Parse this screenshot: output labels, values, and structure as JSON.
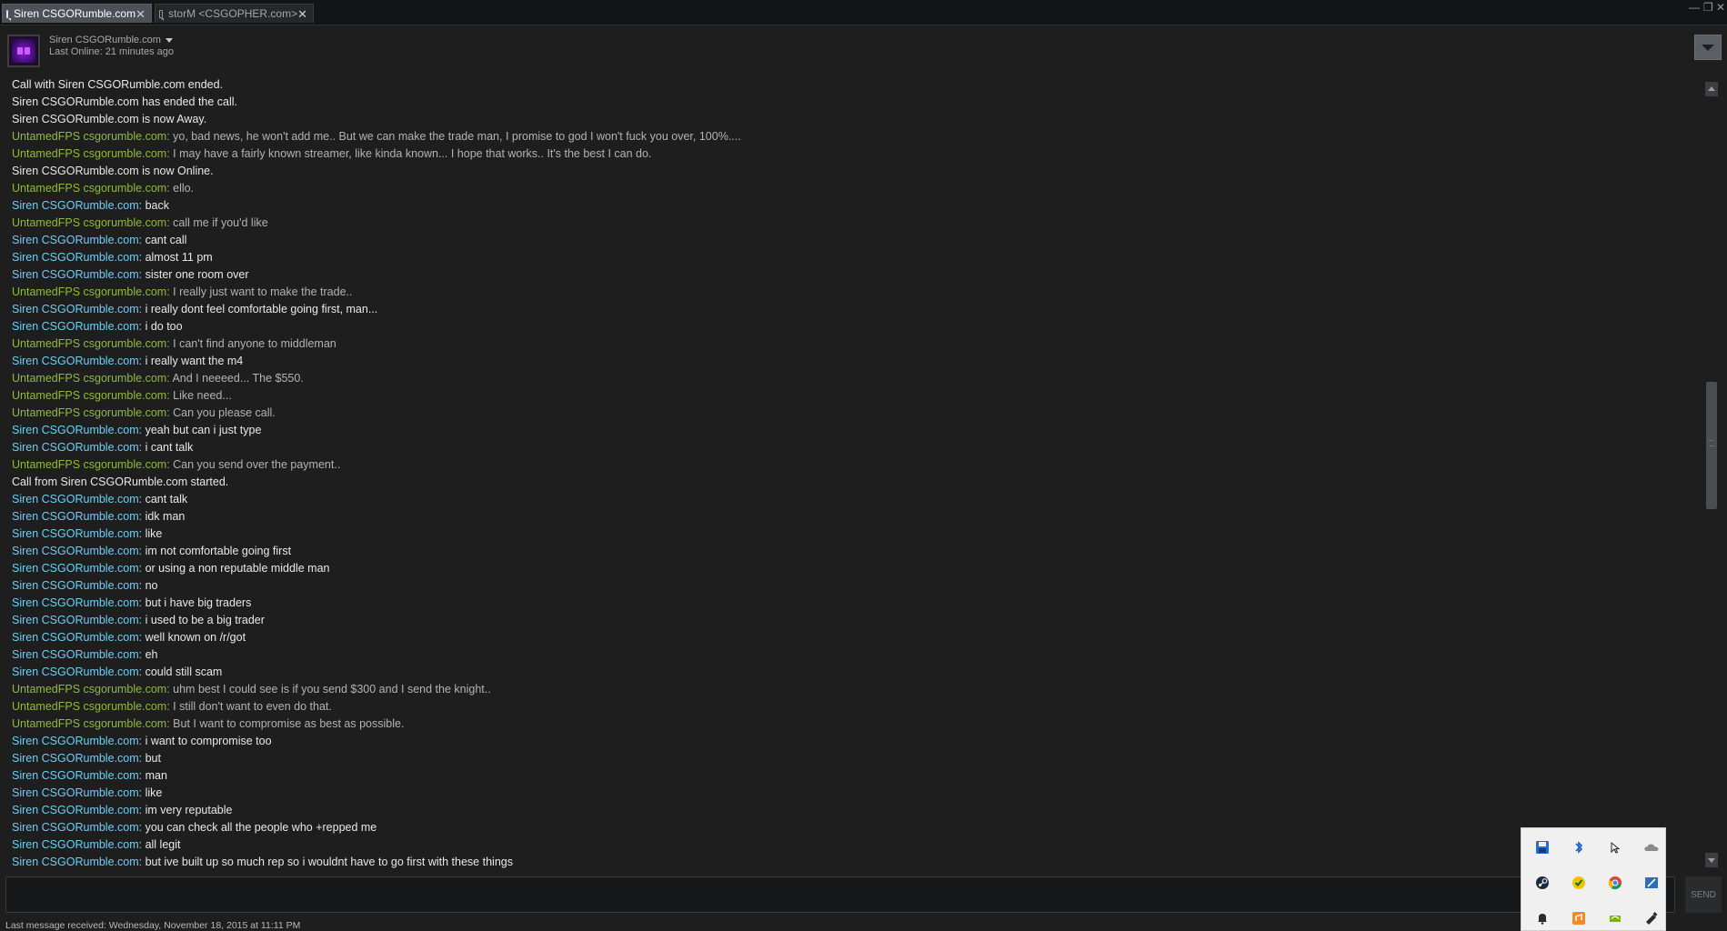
{
  "tabs": [
    {
      "label": "Siren CSGORumble.com",
      "active": true
    },
    {
      "label": "storM <CSGOPHER.com>",
      "active": false
    }
  ],
  "window": {
    "minimize": "—",
    "maximize": "❐",
    "close": "✕"
  },
  "header": {
    "friend_name": "Siren CSGORumble.com",
    "status": "Last Online: 21 minutes ago"
  },
  "colors": {
    "siren": "#6dcff6",
    "untamed": "#90ba3c",
    "system_text": "#e9e9e9",
    "background": "#1e1e1f"
  },
  "messages": [
    {
      "type": "system",
      "text": "Call with Siren CSGORumble.com ended."
    },
    {
      "type": "system",
      "text": "Siren CSGORumble.com has ended the call."
    },
    {
      "type": "system",
      "text": "Siren CSGORumble.com is now Away."
    },
    {
      "type": "msg",
      "who": "untamed",
      "sender": "UntamedFPS csgorumble.com",
      "text": "yo, bad news, he won't add me.. But we can make the trade man, I promise to god I won't fuck you over, 100%...."
    },
    {
      "type": "msg",
      "who": "untamed",
      "sender": "UntamedFPS csgorumble.com",
      "text": "I may have a fairly known streamer, like kinda known... I hope that works.. It's the best I can do."
    },
    {
      "type": "system",
      "text": "Siren CSGORumble.com is now Online."
    },
    {
      "type": "msg",
      "who": "untamed",
      "sender": "UntamedFPS csgorumble.com",
      "text": "ello."
    },
    {
      "type": "msg",
      "who": "siren",
      "sender": "Siren CSGORumble.com",
      "text": "back"
    },
    {
      "type": "msg",
      "who": "untamed",
      "sender": "UntamedFPS csgorumble.com",
      "text": "call me if you'd like"
    },
    {
      "type": "msg",
      "who": "siren",
      "sender": "Siren CSGORumble.com",
      "text": "cant call"
    },
    {
      "type": "msg",
      "who": "siren",
      "sender": "Siren CSGORumble.com",
      "text": "almost 11 pm"
    },
    {
      "type": "msg",
      "who": "siren",
      "sender": "Siren CSGORumble.com",
      "text": "sister one room over"
    },
    {
      "type": "msg",
      "who": "untamed",
      "sender": "UntamedFPS csgorumble.com",
      "text": "I really just want to make the trade.."
    },
    {
      "type": "msg",
      "who": "siren",
      "sender": "Siren CSGORumble.com",
      "text": "i really dont feel comfortable going first, man..."
    },
    {
      "type": "msg",
      "who": "siren",
      "sender": "Siren CSGORumble.com",
      "text": "i do too"
    },
    {
      "type": "msg",
      "who": "untamed",
      "sender": "UntamedFPS csgorumble.com",
      "text": "I can't find anyone to middleman"
    },
    {
      "type": "msg",
      "who": "siren",
      "sender": "Siren CSGORumble.com",
      "text": "i really want the m4"
    },
    {
      "type": "msg",
      "who": "untamed",
      "sender": "UntamedFPS csgorumble.com",
      "text": "And I neeeed... The $550."
    },
    {
      "type": "msg",
      "who": "untamed",
      "sender": "UntamedFPS csgorumble.com",
      "text": "Like need..."
    },
    {
      "type": "msg",
      "who": "untamed",
      "sender": "UntamedFPS csgorumble.com",
      "text": "Can you please call."
    },
    {
      "type": "msg",
      "who": "siren",
      "sender": "Siren CSGORumble.com",
      "text": "yeah but can i just type"
    },
    {
      "type": "msg",
      "who": "siren",
      "sender": "Siren CSGORumble.com",
      "text": "i cant talk"
    },
    {
      "type": "msg",
      "who": "untamed",
      "sender": "UntamedFPS csgorumble.com",
      "text": "Can you send over the payment.."
    },
    {
      "type": "system",
      "text": "Call from Siren CSGORumble.com started."
    },
    {
      "type": "msg",
      "who": "siren",
      "sender": "Siren CSGORumble.com",
      "text": "cant talk"
    },
    {
      "type": "msg",
      "who": "siren",
      "sender": "Siren CSGORumble.com",
      "text": "idk man"
    },
    {
      "type": "msg",
      "who": "siren",
      "sender": "Siren CSGORumble.com",
      "text": "like"
    },
    {
      "type": "msg",
      "who": "siren",
      "sender": "Siren CSGORumble.com",
      "text": "im not comfortable going first"
    },
    {
      "type": "msg",
      "who": "siren",
      "sender": "Siren CSGORumble.com",
      "text": "or using a non reputable middle man"
    },
    {
      "type": "msg",
      "who": "siren",
      "sender": "Siren CSGORumble.com",
      "text": "no"
    },
    {
      "type": "msg",
      "who": "siren",
      "sender": "Siren CSGORumble.com",
      "text": "but i have big traders"
    },
    {
      "type": "msg",
      "who": "siren",
      "sender": "Siren CSGORumble.com",
      "text": "i used to be a big trader"
    },
    {
      "type": "msg",
      "who": "siren",
      "sender": "Siren CSGORumble.com",
      "text": "well known on /r/got"
    },
    {
      "type": "msg",
      "who": "siren",
      "sender": "Siren CSGORumble.com",
      "text": "eh"
    },
    {
      "type": "msg",
      "who": "siren",
      "sender": "Siren CSGORumble.com",
      "text": "could still scam"
    },
    {
      "type": "msg",
      "who": "untamed",
      "sender": "UntamedFPS csgorumble.com",
      "text": "uhm best I could see is if you send $300 and I send the knight.."
    },
    {
      "type": "msg",
      "who": "untamed",
      "sender": "UntamedFPS csgorumble.com",
      "text": "I still don't want to even do that."
    },
    {
      "type": "msg",
      "who": "untamed",
      "sender": "UntamedFPS csgorumble.com",
      "text": "But I want to compromise as best as possible."
    },
    {
      "type": "msg",
      "who": "siren",
      "sender": "Siren CSGORumble.com",
      "text": "i want to compromise too"
    },
    {
      "type": "msg",
      "who": "siren",
      "sender": "Siren CSGORumble.com",
      "text": "but"
    },
    {
      "type": "msg",
      "who": "siren",
      "sender": "Siren CSGORumble.com",
      "text": "man"
    },
    {
      "type": "msg",
      "who": "siren",
      "sender": "Siren CSGORumble.com",
      "text": "like"
    },
    {
      "type": "msg",
      "who": "siren",
      "sender": "Siren CSGORumble.com",
      "text": "im very reputable"
    },
    {
      "type": "msg",
      "who": "siren",
      "sender": "Siren CSGORumble.com",
      "text": "you can check all the people who +repped me"
    },
    {
      "type": "msg",
      "who": "siren",
      "sender": "Siren CSGORumble.com",
      "text": "all legit"
    },
    {
      "type": "msg",
      "who": "siren",
      "sender": "Siren CSGORumble.com",
      "text": "but ive built up so much rep so i wouldnt have to go first with these things"
    }
  ],
  "input": {
    "value": "",
    "placeholder": ""
  },
  "send_label": "SEND",
  "footer": {
    "last_received": "Last message received: Wednesday, November 18, 2015 at 11:11 PM"
  },
  "tray_icons": [
    "floppy-save-icon",
    "bluetooth-icon",
    "mouse-icon",
    "cloud-icon",
    "steam-icon",
    "norton-shield-icon",
    "chrome-icon",
    "pen-tablet-icon",
    "notification-bell-icon",
    "audio-app-icon",
    "nvidia-icon",
    "usb-eject-icon"
  ]
}
